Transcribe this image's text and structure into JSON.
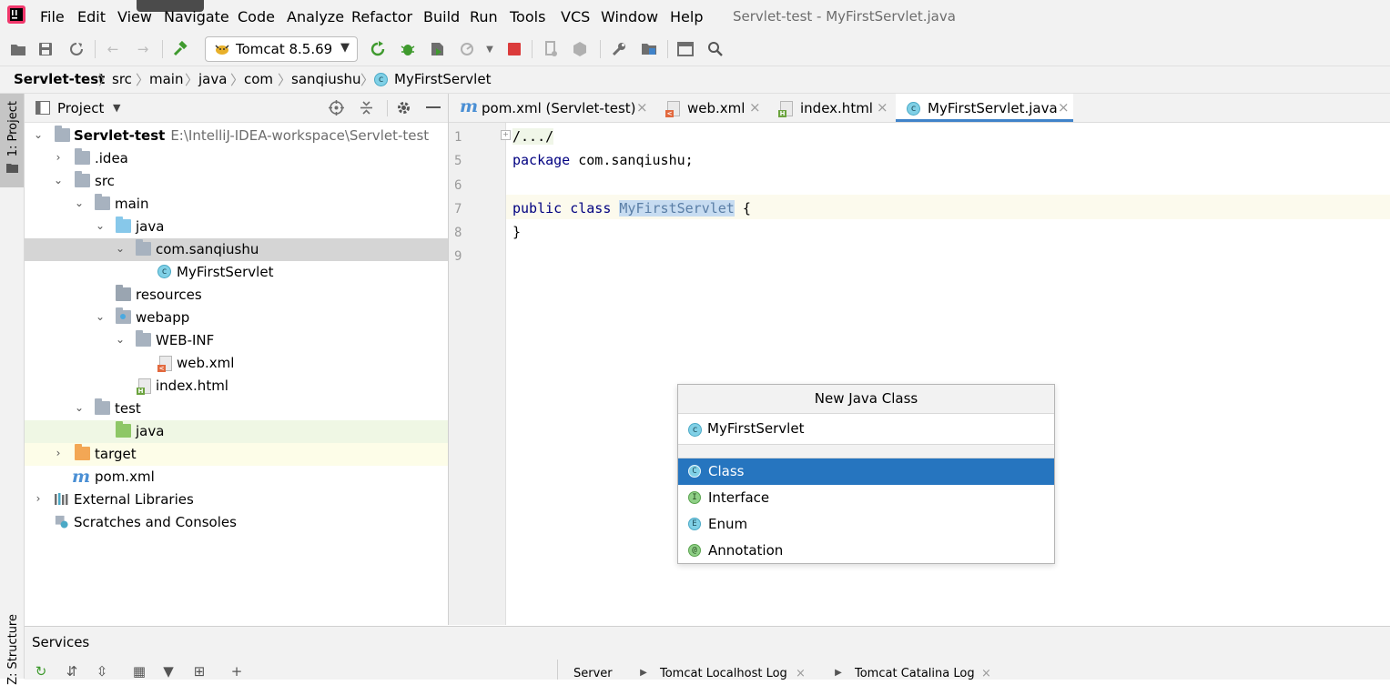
{
  "window": {
    "title": "Servlet-test - MyFirstServlet.java"
  },
  "menu": [
    "File",
    "Edit",
    "View",
    "Navigate",
    "Code",
    "Analyze",
    "Refactor",
    "Build",
    "Run",
    "Tools",
    "VCS",
    "Window",
    "Help"
  ],
  "toolbar": {
    "run_config": "Tomcat 8.5.69"
  },
  "breadcrumb": [
    "Servlet-test",
    "src",
    "main",
    "java",
    "com",
    "sanqiushu",
    "MyFirstServlet"
  ],
  "left_strip": {
    "project_tab": "1: Project",
    "structure_tab": "Z: Structure"
  },
  "project_panel": {
    "title": "Project",
    "tree": [
      {
        "label": "Servlet-test",
        "hint": "E:\\IntelliJ-IDEA-workspace\\Servlet-test",
        "level": 0,
        "arrow": "open",
        "icon": "module-folder",
        "bold": true
      },
      {
        "label": ".idea",
        "level": 1,
        "arrow": "closed",
        "icon": "folder"
      },
      {
        "label": "src",
        "level": 1,
        "arrow": "open",
        "icon": "folder"
      },
      {
        "label": "main",
        "level": 2,
        "arrow": "open",
        "icon": "folder"
      },
      {
        "label": "java",
        "level": 3,
        "arrow": "open",
        "icon": "source-folder"
      },
      {
        "label": "com.sanqiushu",
        "level": 4,
        "arrow": "open",
        "icon": "package",
        "selected": true
      },
      {
        "label": "MyFirstServlet",
        "level": 5,
        "arrow": "none",
        "icon": "class"
      },
      {
        "label": "resources",
        "level": 3,
        "arrow": "none",
        "icon": "resources-folder"
      },
      {
        "label": "webapp",
        "level": 3,
        "arrow": "open",
        "icon": "web-folder"
      },
      {
        "label": "WEB-INF",
        "level": 4,
        "arrow": "open",
        "icon": "folder"
      },
      {
        "label": "web.xml",
        "level": 5,
        "arrow": "none",
        "icon": "xml-file"
      },
      {
        "label": "index.html",
        "level": 4,
        "arrow": "none",
        "icon": "html-file"
      },
      {
        "label": "test",
        "level": 2,
        "arrow": "open",
        "icon": "folder"
      },
      {
        "label": "java",
        "level": 3,
        "arrow": "none",
        "icon": "test-folder",
        "test": true
      },
      {
        "label": "target",
        "level": 1,
        "arrow": "closed",
        "icon": "excluded-folder",
        "excluded": true
      },
      {
        "label": "pom.xml",
        "level": 1,
        "arrow": "none",
        "icon": "maven-file"
      },
      {
        "label": "External Libraries",
        "level": 0,
        "arrow": "closed",
        "icon": "libraries"
      },
      {
        "label": "Scratches and Consoles",
        "level": 0,
        "arrow": "none",
        "icon": "scratches"
      }
    ]
  },
  "editor": {
    "tabs": [
      {
        "label": "pom.xml (Servlet-test)",
        "icon": "maven-file"
      },
      {
        "label": "web.xml",
        "icon": "xml-file"
      },
      {
        "label": "index.html",
        "icon": "html-file"
      },
      {
        "label": "MyFirstServlet.java",
        "icon": "class",
        "active": true
      }
    ],
    "line_numbers": [
      "1",
      "5",
      "6",
      "7",
      "8",
      "9"
    ],
    "lines": {
      "l1": "/.../",
      "l5_kw": "package",
      "l5_rest": " com.sanqiushu;",
      "l7_kw": "public class",
      "l7_name": "MyFirstServlet",
      "l7_rest": " {",
      "l8": "}"
    }
  },
  "new_class_popup": {
    "title": "New Java Class",
    "name_value": "MyFirstServlet",
    "kinds": [
      {
        "label": "Class",
        "icon_letter": "C",
        "selected": true
      },
      {
        "label": "Interface",
        "icon_letter": "I"
      },
      {
        "label": "Enum",
        "icon_letter": "E"
      },
      {
        "label": "Annotation",
        "icon_letter": "@"
      }
    ]
  },
  "services": {
    "title": "Services",
    "tabs": [
      "Server",
      "Tomcat Localhost Log",
      "Tomcat Catalina Log"
    ]
  },
  "colors": {
    "selection_blue": "#2675bf",
    "tab_underline": "#4083c9",
    "keyword": "#000080",
    "class_icon": "#80d0e6"
  }
}
